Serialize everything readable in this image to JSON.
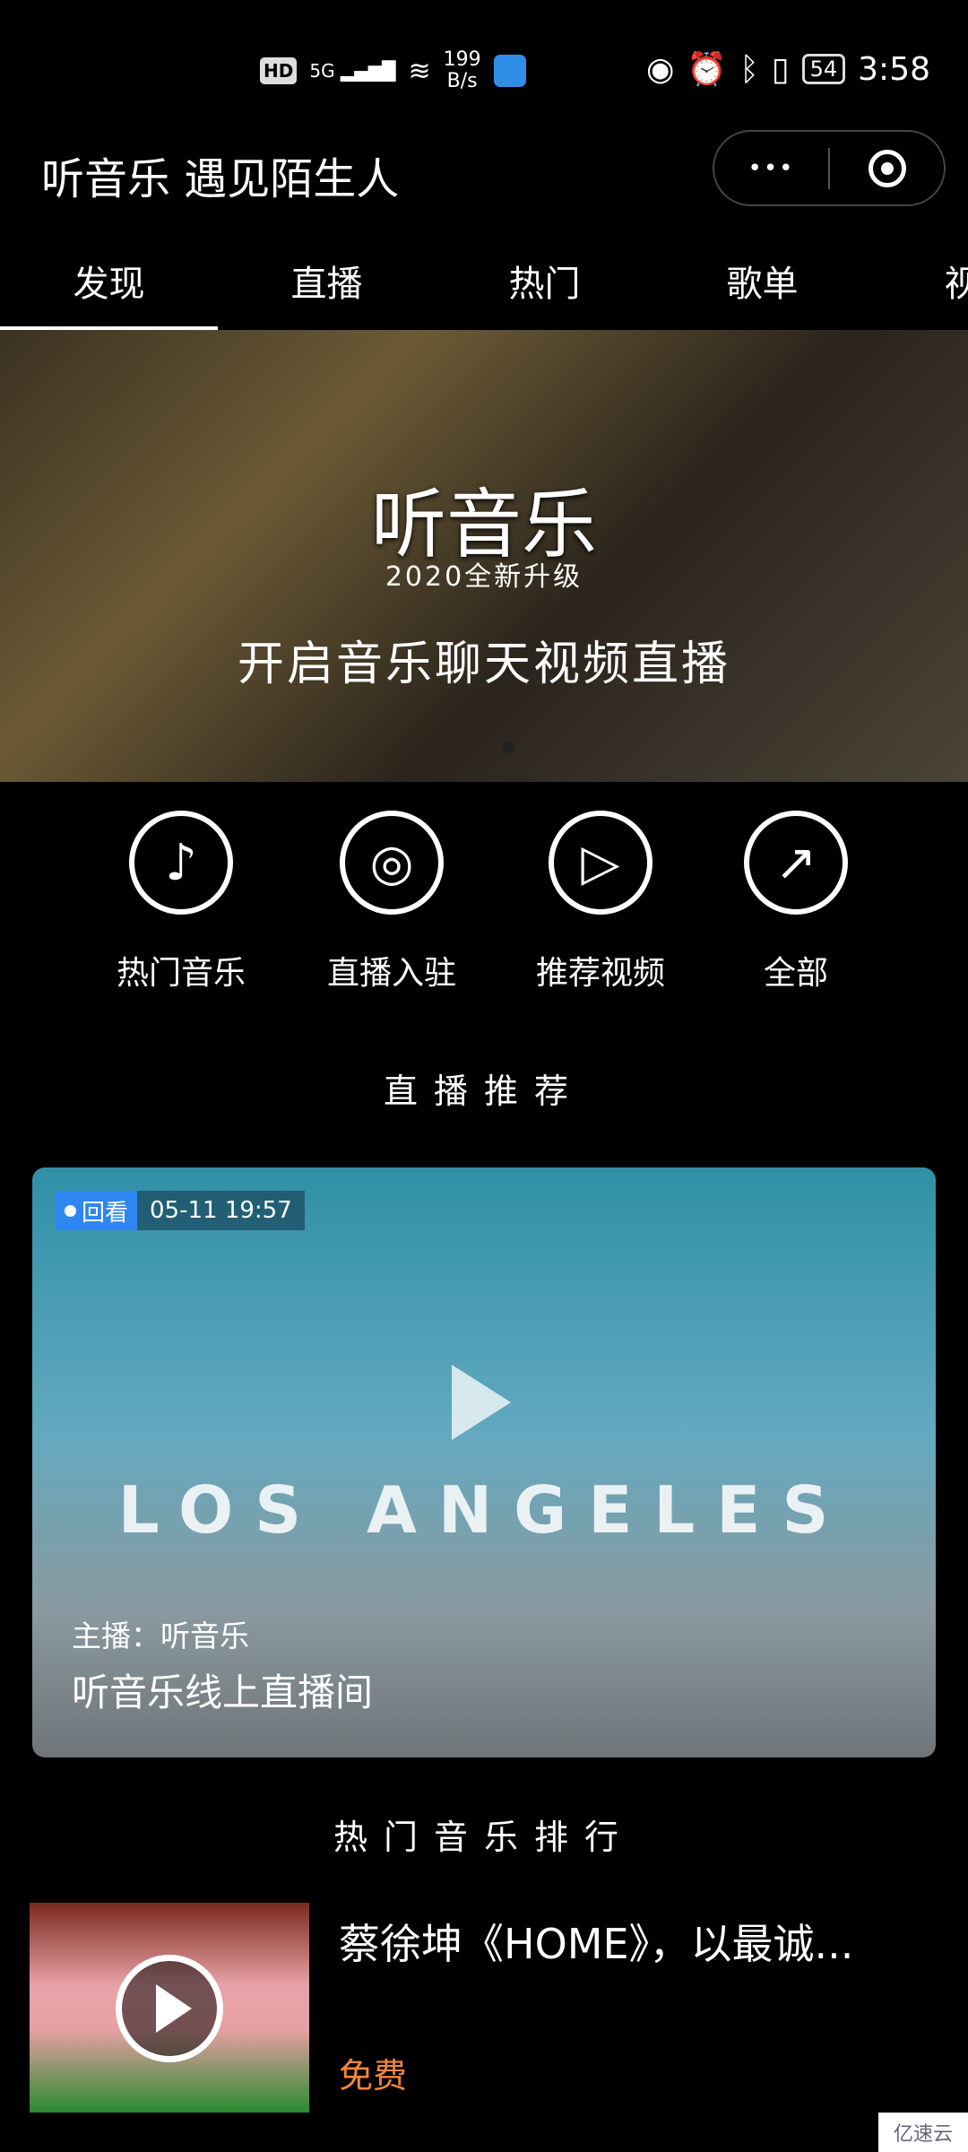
{
  "status_bar": {
    "network": "5G",
    "speed_value": "199",
    "speed_unit": "B/s",
    "hd": "HD",
    "battery": "54",
    "time": "3:58"
  },
  "header": {
    "title": "听音乐 遇见陌生人",
    "more_icon": "•••"
  },
  "tabs": [
    {
      "label": "发现",
      "active": true
    },
    {
      "label": "直播"
    },
    {
      "label": "热门"
    },
    {
      "label": "歌单"
    },
    {
      "label": "视频"
    }
  ],
  "banner": {
    "title": "听音乐",
    "subtitle": "2020全新升级",
    "slogan": "开启音乐聊天视频直播"
  },
  "quick_icons": [
    {
      "label": "热门音乐",
      "icon": "music-note-icon",
      "glyph": "♪"
    },
    {
      "label": "直播入驻",
      "icon": "disc-icon",
      "glyph": "◎"
    },
    {
      "label": "推荐视频",
      "icon": "play-icon",
      "glyph": "▷"
    },
    {
      "label": "全部",
      "icon": "all-icon",
      "glyph": "↗"
    }
  ],
  "live_section": {
    "title": "直播推荐",
    "card": {
      "badge": "回看",
      "time": "05-11 19:57",
      "overlay_text": "LOS ANGELES",
      "host": "主播：听音乐",
      "room": "听音乐线上直播间"
    }
  },
  "rank_section": {
    "title": "热门音乐排行",
    "items": [
      {
        "title": "蔡徐坤《HOME》，以最诚...",
        "price": "免费"
      }
    ]
  },
  "watermark": "亿速云",
  "colors": {
    "accent_blue": "#2f86f0",
    "price_orange": "#f0883a",
    "background": "#000000"
  }
}
